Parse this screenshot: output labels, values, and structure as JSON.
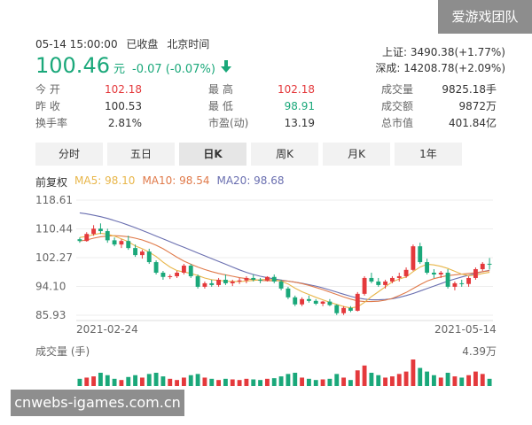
{
  "watermark_top": "爱游戏团队",
  "watermark_bottom": "cnwebs-igames.com.cn",
  "header": {
    "datetime": "05-14 15:00:00",
    "status": "已收盘",
    "timezone": "北京时间"
  },
  "quote": {
    "price": "100.46",
    "unit": "元",
    "change": "-0.07 (-0.07%)",
    "color_down": "#1aa87a",
    "color_up": "#e4393c"
  },
  "indices": {
    "shanghai": "上证: 3490.38(+1.77%)",
    "shenzhen": "深成: 14208.78(+2.09%)"
  },
  "stats": {
    "open_label": "今 开",
    "open": "102.18",
    "high_label": "最 高",
    "high": "102.18",
    "volume_label": "成交量",
    "volume": "9825.18手",
    "prev_label": "昨 收",
    "prev": "100.53",
    "low_label": "最 低",
    "low": "98.91",
    "amount_label": "成交额",
    "amount": "9872万",
    "turnover_label": "换手率",
    "turnover": "2.81%",
    "pe_label": "市盈(动)",
    "pe": "13.19",
    "mcap_label": "总市值",
    "mcap": "401.84亿"
  },
  "tabs": [
    {
      "label": "分时"
    },
    {
      "label": "五日"
    },
    {
      "label": "日K"
    },
    {
      "label": "周K"
    },
    {
      "label": "月K"
    },
    {
      "label": "1年"
    }
  ],
  "active_tab": "日K",
  "ma": {
    "adjust": "前复权",
    "ma5": "MA5: 98.10",
    "ma10": "MA10: 98.54",
    "ma20": "MA20: 98.68",
    "ma5_color": "#e8b64a",
    "ma10_color": "#e07a4a",
    "ma20_color": "#6a6fb0"
  },
  "volume_label": "成交量 (手)",
  "volume_max": "4.39万",
  "chart_data": {
    "type": "candlestick",
    "y_ticks": [
      "118.61",
      "110.44",
      "102.27",
      "94.10",
      "85.93"
    ],
    "ylim": [
      85.93,
      118.61
    ],
    "x_labels": [
      "2021-02-24",
      "2021-05-14"
    ],
    "candles": [
      [
        107.5,
        108.0,
        106.5,
        107.0
      ],
      [
        107.0,
        109.5,
        106.8,
        109.0
      ],
      [
        109.0,
        111.5,
        108.5,
        110.5
      ],
      [
        110.5,
        112.0,
        109.0,
        109.8
      ],
      [
        109.8,
        110.5,
        106.5,
        107.2
      ],
      [
        107.2,
        108.0,
        105.5,
        106.0
      ],
      [
        106.0,
        107.5,
        105.0,
        107.0
      ],
      [
        107.0,
        108.5,
        104.5,
        105.0
      ],
      [
        105.0,
        106.0,
        102.5,
        103.0
      ],
      [
        103.0,
        104.5,
        102.0,
        104.0
      ],
      [
        104.0,
        104.8,
        100.5,
        101.0
      ],
      [
        101.0,
        101.5,
        97.5,
        98.0
      ],
      [
        98.0,
        98.5,
        96.0,
        96.8
      ],
      [
        96.8,
        97.5,
        96.2,
        97.0
      ],
      [
        97.0,
        98.5,
        96.5,
        98.0
      ],
      [
        98.0,
        100.5,
        97.5,
        100.0
      ],
      [
        100.0,
        100.5,
        96.5,
        97.0
      ],
      [
        97.0,
        97.5,
        93.5,
        94.0
      ],
      [
        94.0,
        95.5,
        93.5,
        95.0
      ],
      [
        95.0,
        96.0,
        94.0,
        94.5
      ],
      [
        94.5,
        96.5,
        94.0,
        96.0
      ],
      [
        96.0,
        97.5,
        94.5,
        95.0
      ],
      [
        95.0,
        96.0,
        94.2,
        95.5
      ],
      [
        95.5,
        96.5,
        94.8,
        95.8
      ],
      [
        95.8,
        97.0,
        95.0,
        96.5
      ],
      [
        96.5,
        97.5,
        95.5,
        96.0
      ],
      [
        96.0,
        96.5,
        95.0,
        95.8
      ],
      [
        95.8,
        97.0,
        95.5,
        96.8
      ],
      [
        96.8,
        97.5,
        95.0,
        95.5
      ],
      [
        95.5,
        96.0,
        93.0,
        93.5
      ],
      [
        93.5,
        94.0,
        90.5,
        91.0
      ],
      [
        91.0,
        91.5,
        88.5,
        89.0
      ],
      [
        89.0,
        91.0,
        88.5,
        90.5
      ],
      [
        90.5,
        91.5,
        89.5,
        90.0
      ],
      [
        90.0,
        90.5,
        88.8,
        89.2
      ],
      [
        89.2,
        90.0,
        88.5,
        89.8
      ],
      [
        89.8,
        90.5,
        88.5,
        88.8
      ],
      [
        88.8,
        89.0,
        86.0,
        86.5
      ],
      [
        86.5,
        88.5,
        86.0,
        88.0
      ],
      [
        88.0,
        88.5,
        86.8,
        87.2
      ],
      [
        87.2,
        92.5,
        87.0,
        92.0
      ],
      [
        92.0,
        97.0,
        91.5,
        96.5
      ],
      [
        96.5,
        98.0,
        95.0,
        95.5
      ],
      [
        95.5,
        96.5,
        94.0,
        94.5
      ],
      [
        94.5,
        96.0,
        93.5,
        95.5
      ],
      [
        95.5,
        97.0,
        95.0,
        96.5
      ],
      [
        96.5,
        98.0,
        95.5,
        97.0
      ],
      [
        97.0,
        99.5,
        96.5,
        98.8
      ],
      [
        98.8,
        106.0,
        98.5,
        105.5
      ],
      [
        105.5,
        106.5,
        100.5,
        101.0
      ],
      [
        101.0,
        102.0,
        97.5,
        98.0
      ],
      [
        98.0,
        99.0,
        96.5,
        97.5
      ],
      [
        97.5,
        98.5,
        96.5,
        98.0
      ],
      [
        98.0,
        99.0,
        93.5,
        94.0
      ],
      [
        94.0,
        95.5,
        93.0,
        95.0
      ],
      [
        95.0,
        96.0,
        94.0,
        94.8
      ],
      [
        94.8,
        97.0,
        94.0,
        96.5
      ],
      [
        96.5,
        99.5,
        96.0,
        99.0
      ],
      [
        99.0,
        101.0,
        98.5,
        100.53
      ],
      [
        100.53,
        102.18,
        98.91,
        100.46
      ]
    ],
    "ma5": [
      108,
      108.3,
      108.8,
      109.2,
      108.9,
      108.4,
      107.6,
      106.8,
      105.6,
      104.8,
      103.8,
      102.6,
      101.0,
      99.6,
      98.6,
      98.2,
      97.8,
      97.2,
      96.5,
      96.0,
      95.8,
      95.6,
      95.5,
      95.5,
      95.6,
      95.8,
      96.0,
      96.1,
      96.0,
      95.6,
      94.8,
      93.6,
      92.6,
      91.8,
      91.0,
      90.3,
      89.6,
      89.0,
      88.4,
      88.0,
      88.3,
      89.6,
      91.2,
      92.6,
      94.0,
      95.4,
      96.2,
      96.8,
      98.3,
      99.6,
      100.4,
      100.2,
      99.8,
      99.2,
      98.4,
      97.6,
      97.2,
      97.3,
      97.8,
      98.1
    ],
    "ma10": [
      107,
      107.3,
      107.8,
      108.2,
      108.4,
      108.5,
      108.4,
      108.2,
      107.8,
      107.3,
      106.6,
      105.8,
      104.8,
      103.6,
      102.4,
      101.3,
      100.4,
      99.6,
      98.9,
      98.3,
      97.8,
      97.4,
      97.0,
      96.6,
      96.3,
      96.0,
      95.8,
      95.7,
      95.7,
      95.7,
      95.6,
      95.3,
      94.9,
      94.4,
      93.8,
      93.2,
      92.5,
      91.8,
      91.1,
      90.5,
      90.0,
      89.8,
      89.8,
      89.9,
      90.2,
      90.7,
      91.5,
      92.4,
      93.5,
      94.6,
      95.6,
      96.3,
      96.8,
      97.2,
      97.4,
      97.6,
      97.8,
      98.0,
      98.3,
      98.54
    ],
    "ma20": [
      115,
      114.7,
      114.3,
      113.9,
      113.4,
      112.8,
      112.2,
      111.5,
      110.8,
      110.0,
      109.2,
      108.4,
      107.6,
      106.8,
      106.0,
      105.2,
      104.4,
      103.6,
      102.8,
      102.0,
      101.2,
      100.4,
      99.6,
      98.8,
      98.1,
      97.5,
      97.0,
      96.6,
      96.2,
      95.9,
      95.6,
      95.3,
      95.0,
      94.6,
      94.2,
      93.7,
      93.1,
      92.5,
      91.9,
      91.3,
      90.8,
      90.5,
      90.3,
      90.3,
      90.4,
      90.6,
      91.0,
      91.5,
      92.1,
      92.8,
      93.5,
      94.2,
      94.9,
      95.6,
      96.2,
      96.8,
      97.3,
      97.8,
      98.3,
      98.68
    ],
    "volume": [
      12,
      14,
      16,
      22,
      18,
      12,
      10,
      15,
      18,
      14,
      20,
      22,
      16,
      12,
      10,
      14,
      18,
      20,
      14,
      12,
      10,
      12,
      11,
      10,
      12,
      11,
      10,
      12,
      13,
      16,
      20,
      22,
      14,
      12,
      10,
      11,
      12,
      20,
      14,
      10,
      26,
      34,
      22,
      18,
      14,
      16,
      20,
      24,
      44,
      30,
      24,
      18,
      14,
      22,
      16,
      14,
      18,
      24,
      20,
      12
    ]
  }
}
